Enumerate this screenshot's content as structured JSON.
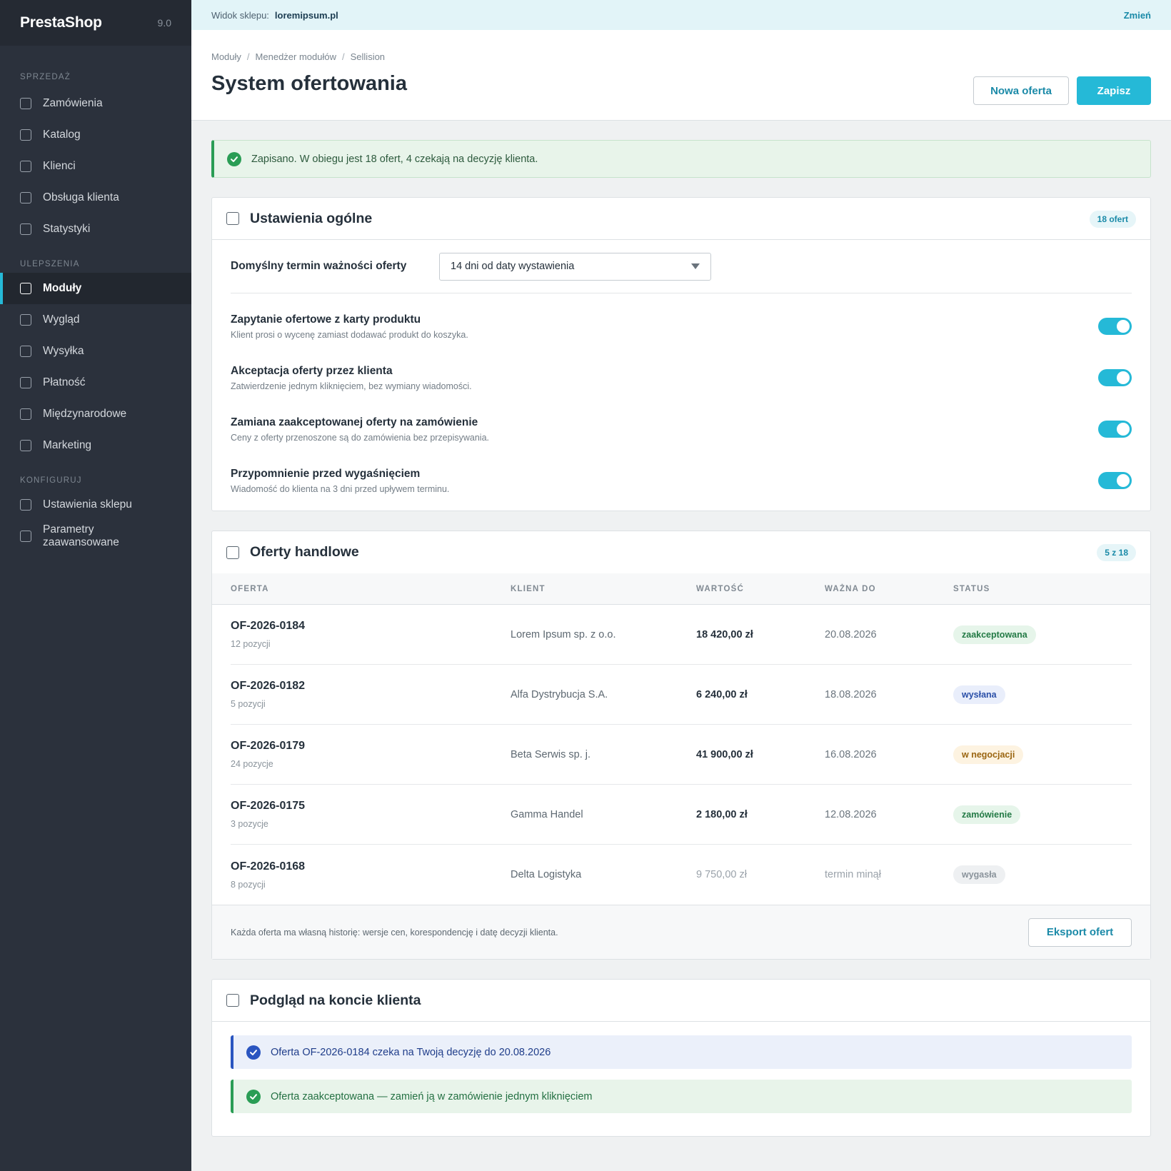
{
  "brand": {
    "name": "PrestaShop",
    "version": "9.0"
  },
  "sidebar": {
    "sections": [
      {
        "title": "SPRZEDAŻ",
        "items": [
          "Zamówienia",
          "Katalog",
          "Klienci",
          "Obsługa klienta",
          "Statystyki"
        ]
      },
      {
        "title": "ULEPSZENIA",
        "items": [
          "Moduły",
          "Wygląd",
          "Wysyłka",
          "Płatność",
          "Międzynarodowe",
          "Marketing"
        ]
      },
      {
        "title": "KONFIGURUJ",
        "items": [
          "Ustawienia sklepu",
          "Parametry zaawansowane"
        ]
      }
    ],
    "active_item": "Moduły"
  },
  "shopbar": {
    "label": "Widok sklepu:",
    "shop": "loremipsum.pl",
    "change": "Zmień"
  },
  "breadcrumb": [
    "Moduły",
    "Menedżer modułów",
    "Sellision"
  ],
  "page": {
    "title": "System ofertowania",
    "new_offer_label": "Nowa oferta",
    "save_label": "Zapisz"
  },
  "alert": {
    "text": "Zapisano. W obiegu jest 18 ofert, 4 czekają na decyzję klienta."
  },
  "general": {
    "title": "Ustawienia ogólne",
    "count": "18 ofert",
    "validity_label": "Domyślny termin ważności oferty",
    "validity_value": "14 dni od daty wystawienia",
    "toggles": [
      {
        "title": "Zapytanie ofertowe z karty produktu",
        "desc": "Klient prosi o wycenę zamiast dodawać produkt do koszyka.",
        "on": true
      },
      {
        "title": "Akceptacja oferty przez klienta",
        "desc": "Zatwierdzenie jednym kliknięciem, bez wymiany wiadomości.",
        "on": true
      },
      {
        "title": "Zamiana zaakceptowanej oferty na zamówienie",
        "desc": "Ceny z oferty przenoszone są do zamówienia bez przepisywania.",
        "on": true
      },
      {
        "title": "Przypomnienie przed wygaśnięciem",
        "desc": "Wiadomość do klienta na 3 dni przed upływem terminu.",
        "on": true
      }
    ]
  },
  "offers": {
    "title": "Oferty handlowe",
    "count": "5 z 18",
    "columns": [
      "OFERTA",
      "KLIENT",
      "WARTOŚĆ",
      "WAŻNA DO",
      "STATUS"
    ],
    "rows": [
      {
        "id": "OF-2026-0184",
        "positions": "12 pozycji",
        "client": "Lorem Ipsum sp. z o.o.",
        "value": "18 420,00 zł",
        "valid": "20.08.2026",
        "status": "zaakceptowana",
        "status_bg": "#e6f5ea",
        "status_fg": "#237a45",
        "expired": false
      },
      {
        "id": "OF-2026-0182",
        "positions": "5 pozycji",
        "client": "Alfa Dystrybucja S.A.",
        "value": "6 240,00 zł",
        "valid": "18.08.2026",
        "status": "wysłana",
        "status_bg": "#e9eefb",
        "status_fg": "#2a4fa8",
        "expired": false
      },
      {
        "id": "OF-2026-0179",
        "positions": "24 pozycje",
        "client": "Beta Serwis sp. j.",
        "value": "41 900,00 zł",
        "valid": "16.08.2026",
        "status": "w negocjacji",
        "status_bg": "#fdf3e1",
        "status_fg": "#9a6510",
        "expired": false
      },
      {
        "id": "OF-2026-0175",
        "positions": "3 pozycje",
        "client": "Gamma Handel",
        "value": "2 180,00 zł",
        "valid": "12.08.2026",
        "status": "zamówienie",
        "status_bg": "#e6f5ea",
        "status_fg": "#237a45",
        "expired": false
      },
      {
        "id": "OF-2026-0168",
        "positions": "8 pozycji",
        "client": "Delta Logistyka",
        "value": "9 750,00 zł",
        "valid": "termin minął",
        "status": "wygasła",
        "status_bg": "#eef0f2",
        "status_fg": "#8a939b",
        "expired": true
      }
    ],
    "footer_text": "Każda oferta ma własną historię: wersje cen, korespondencję i datę decyzji klienta.",
    "export_label": "Eksport ofert"
  },
  "preview": {
    "title": "Podgląd na koncie klienta",
    "notices": [
      {
        "type": "info",
        "text": "Oferta OF-2026-0184 czeka na Twoją decyzję do 20.08.2026"
      },
      {
        "type": "ok",
        "text": "Oferta zaakceptowana — zamień ją w zamówienie jednym kliknięciem"
      }
    ]
  }
}
